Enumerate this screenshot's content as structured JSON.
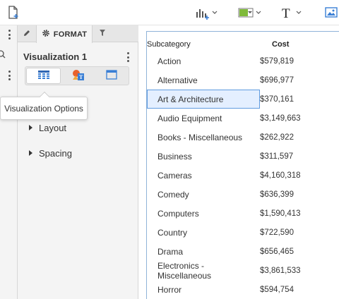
{
  "toolbar": {
    "icons": [
      "add-page-icon",
      "add-chart-icon",
      "bar-chart-dropdown-icon",
      "color-fill-icon",
      "text-icon",
      "image-icon"
    ]
  },
  "rail": {
    "icons": [
      "more-options-icon",
      "search-icon",
      "more-options-icon"
    ]
  },
  "panel": {
    "tabs": [
      {
        "name": "edit",
        "label": ""
      },
      {
        "name": "format",
        "label": "FORMAT"
      },
      {
        "name": "filter",
        "label": ""
      }
    ],
    "viz_title": "Visualization 1",
    "seg_buttons": [
      "grid-view-icon",
      "shapes-icon",
      "window-icon"
    ],
    "tooltip": "Visualization Options",
    "sections": [
      "Layout",
      "Spacing"
    ]
  },
  "table": {
    "headers": {
      "subcategory": "Subcategory",
      "cost": "Cost"
    },
    "rows": [
      {
        "subcategory": "Action",
        "cost": "$579,819"
      },
      {
        "subcategory": "Alternative",
        "cost": "$696,977"
      },
      {
        "subcategory": "Art & Architecture",
        "cost": "$370,161"
      },
      {
        "subcategory": "Audio Equipment",
        "cost": "$3,149,663"
      },
      {
        "subcategory": "Books - Miscellaneous",
        "cost": "$262,922"
      },
      {
        "subcategory": "Business",
        "cost": "$311,597"
      },
      {
        "subcategory": "Cameras",
        "cost": "$4,160,318"
      },
      {
        "subcategory": "Comedy",
        "cost": "$636,399"
      },
      {
        "subcategory": "Computers",
        "cost": "$1,590,413"
      },
      {
        "subcategory": "Country",
        "cost": "$722,590"
      },
      {
        "subcategory": "Drama",
        "cost": "$656,465"
      },
      {
        "subcategory": "Electronics - Miscellaneous",
        "cost": "$3,861,533"
      },
      {
        "subcategory": "Horror",
        "cost": "$594,754"
      }
    ],
    "selected_row": 2
  },
  "colors": {
    "accent": "#3a7fd5",
    "selection_fill": "#e4efff",
    "selection_border": "#5f9be0",
    "panel_bg": "#f4f4f4"
  }
}
